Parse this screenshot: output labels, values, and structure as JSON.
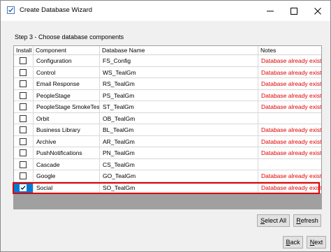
{
  "window": {
    "title": "Create Database Wizard",
    "icon": "checkbox-app-icon"
  },
  "step_label": "Step 3 - Choose database components",
  "grid": {
    "headers": {
      "install": "Install",
      "component": "Component",
      "database_name": "Database Name",
      "notes": "Notes"
    },
    "rows": [
      {
        "installed": false,
        "component": "Configuration",
        "database_name": "FS_Config",
        "notes": "Database already exists"
      },
      {
        "installed": false,
        "component": "Control",
        "database_name": "WS_TealGm",
        "notes": "Database already exists"
      },
      {
        "installed": false,
        "component": "Email Response",
        "database_name": "RS_TealGm",
        "notes": "Database already exists"
      },
      {
        "installed": false,
        "component": "PeopleStage",
        "database_name": "PS_TealGm",
        "notes": "Database already exists"
      },
      {
        "installed": false,
        "component": "PeopleStage SmokeTest",
        "database_name": "ST_TealGm",
        "notes": "Database already exists"
      },
      {
        "installed": false,
        "component": "Orbit",
        "database_name": "OB_TealGm",
        "notes": ""
      },
      {
        "installed": false,
        "component": "Business Library",
        "database_name": "BL_TealGm",
        "notes": "Database already exists"
      },
      {
        "installed": false,
        "component": "Archive",
        "database_name": "AR_TealGm",
        "notes": "Database already exists"
      },
      {
        "installed": false,
        "component": "PushNotifications",
        "database_name": "PN_TealGm",
        "notes": "Database already exists"
      },
      {
        "installed": false,
        "component": "Cascade",
        "database_name": "CS_TealGm",
        "notes": ""
      },
      {
        "installed": false,
        "component": "Google",
        "database_name": "GO_TealGm",
        "notes": "Database already exists"
      },
      {
        "installed": true,
        "component": "Social",
        "database_name": "SO_TealGm",
        "notes": "Database already exists",
        "selected": true
      }
    ]
  },
  "buttons": {
    "select_all": {
      "mnemonic": "S",
      "rest": "elect All"
    },
    "refresh": {
      "mnemonic": "R",
      "rest": "efresh"
    },
    "back": {
      "mnemonic": "B",
      "rest": "ack"
    },
    "next": {
      "mnemonic": "N",
      "rest": "ext"
    }
  },
  "colors": {
    "notes_text": "#e00000",
    "selection_outline": "#e00000",
    "selected_cell": "#0078d7"
  }
}
